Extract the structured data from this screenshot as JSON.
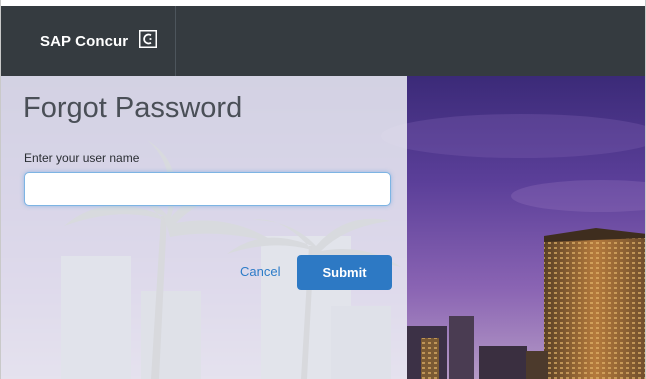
{
  "header": {
    "brand_name": "SAP Concur",
    "brand_logo": "concur-c-logo-icon",
    "background_color": "#353b40"
  },
  "form": {
    "title": "Forgot Password",
    "username_label": "Enter your user name",
    "username_value": "",
    "cancel_label": "Cancel",
    "submit_label": "Submit"
  },
  "colors": {
    "accent": "#2d79c4",
    "link": "#2d7cc8",
    "panel": "#eceef4"
  }
}
